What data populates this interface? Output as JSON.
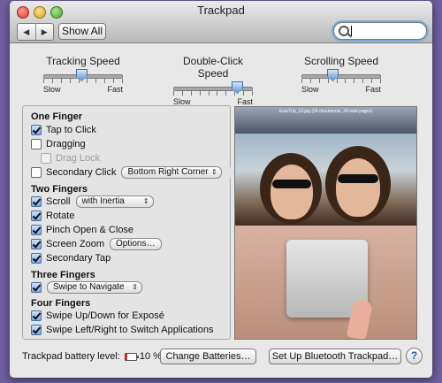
{
  "window": {
    "title": "Trackpad"
  },
  "toolbar": {
    "back_glyph": "◀",
    "forward_glyph": "▶",
    "show_all_label": "Show All",
    "search_value": ""
  },
  "speeds": [
    {
      "label": "Tracking Speed",
      "min": "Slow",
      "max": "Fast",
      "level": 0.45
    },
    {
      "label": "Double-Click Speed",
      "min": "Slow",
      "max": "Fast",
      "level": 0.82
    },
    {
      "label": "Scrolling Speed",
      "min": "Slow",
      "max": "Fast",
      "level": 0.35
    }
  ],
  "one_finger": {
    "heading": "One Finger",
    "tap_to_click": "Tap to Click",
    "dragging": "Dragging",
    "drag_lock": "Drag Lock",
    "secondary_click": "Secondary Click",
    "secondary_click_option": "Bottom Right Corner"
  },
  "two_fingers": {
    "heading": "Two Fingers",
    "scroll": "Scroll",
    "scroll_option": "with Inertia",
    "rotate": "Rotate",
    "pinch": "Pinch Open & Close",
    "screen_zoom": "Screen Zoom",
    "options_label": "Options…",
    "secondary_tap": "Secondary Tap"
  },
  "three_fingers": {
    "heading": "Three Fingers",
    "swipe_option": "Swipe to Navigate"
  },
  "four_fingers": {
    "heading": "Four Fingers",
    "swipe_updown": "Swipe Up/Down for Exposé",
    "swipe_leftright": "Swipe Left/Right to Switch Applications"
  },
  "media": {
    "caption": "EuroTrip_10.jpg (24 documents, 24 total pages)"
  },
  "footer": {
    "battery_label": "Trackpad battery level:",
    "battery_percent": "10 %",
    "battery_level": 0.1,
    "change_batteries_label": "Change Batteries…",
    "setup_label": "Set Up Bluetooth Trackpad…",
    "help_label": "?"
  }
}
